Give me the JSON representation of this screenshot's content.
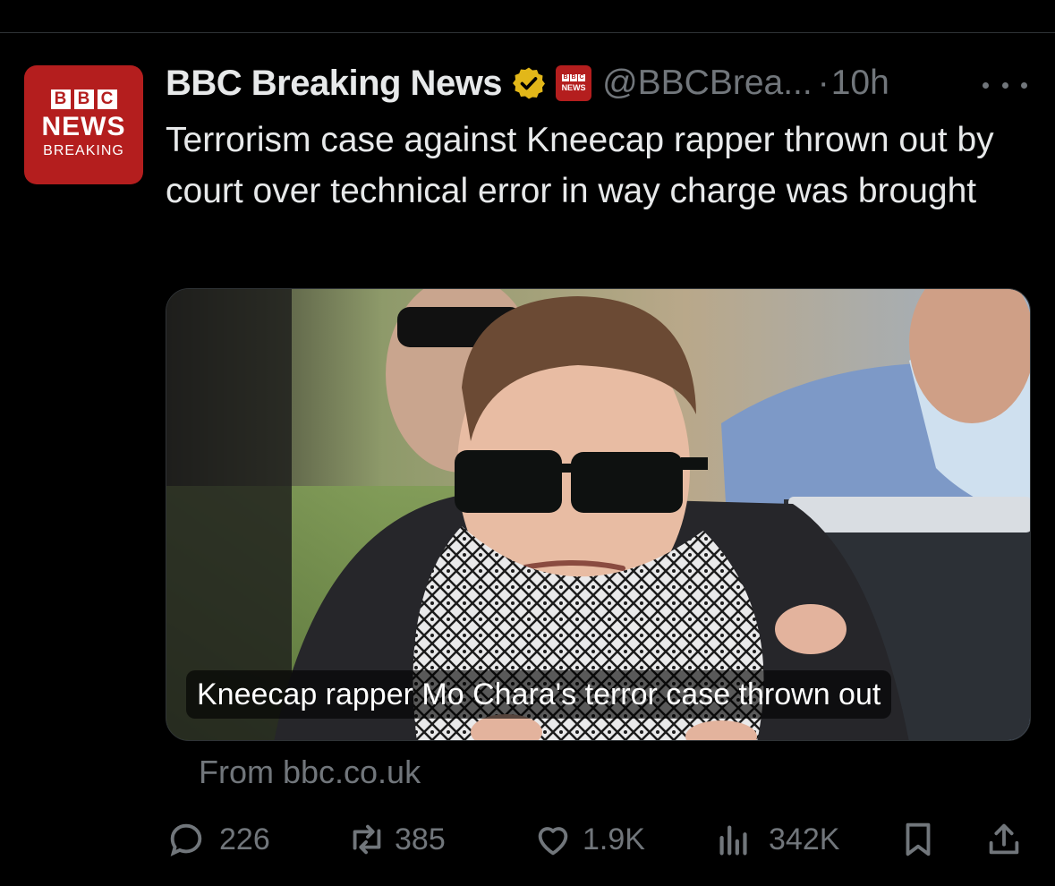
{
  "tweet": {
    "author": {
      "display_name": "BBC Breaking News",
      "handle": "@BBCBrea...",
      "avatar": {
        "blocks": [
          "B",
          "B",
          "C"
        ],
        "line1": "NEWS",
        "line2": "BREAKING"
      },
      "affiliation_badge": {
        "blocks": [
          "B",
          "B",
          "C"
        ],
        "text": "NEWS"
      }
    },
    "separator": "·",
    "time": "10h",
    "text": "Terrorism case against Kneecap rapper thrown out by court over technical error in way charge was brought",
    "card": {
      "caption": "Kneecap rapper Mo Chara's terror case thrown out",
      "source": "From bbc.co.uk"
    },
    "stats": {
      "replies": "226",
      "reposts": "385",
      "likes": "1.9K",
      "views": "342K"
    }
  },
  "icons": {
    "verified": "verified-badge-icon",
    "more": "more-options-icon",
    "reply": "reply-icon",
    "repost": "repost-icon",
    "like": "like-icon",
    "views": "views-icon",
    "bookmark": "bookmark-icon",
    "share": "share-icon"
  },
  "colors": {
    "background": "#000000",
    "text": "#e7e9ea",
    "muted": "#71767b",
    "bbc_red": "#b41e1e",
    "verified_gold": "#e2b719"
  }
}
